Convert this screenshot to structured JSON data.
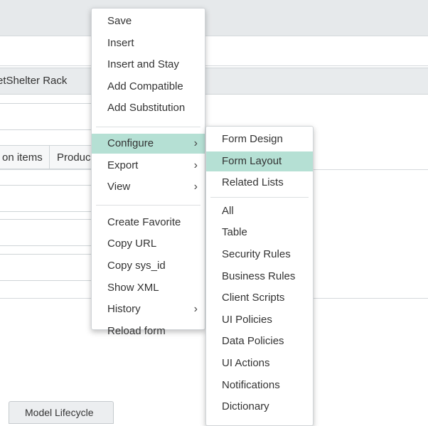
{
  "background": {
    "graybar_text": "etShelter Rack",
    "tabs": [
      "on items",
      "Produc"
    ],
    "bottom_tab": "Model Lifecycle"
  },
  "context_menu": {
    "groups": [
      [
        "Save",
        "Insert",
        "Insert and Stay",
        "Add Compatible",
        "Add Substitution"
      ],
      [
        "Configure",
        "Export",
        "View"
      ],
      [
        "Create Favorite",
        "Copy URL",
        "Copy sys_id",
        "Show XML",
        "History",
        "Reload form"
      ]
    ],
    "submenu_items": [
      "Configure",
      "Export",
      "View",
      "History"
    ],
    "active_item": "Configure",
    "chevron": "chevron-right-icon"
  },
  "configure_submenu": {
    "groups": [
      [
        "Form Design",
        "Form Layout",
        "Related Lists"
      ],
      [
        "All",
        "Table",
        "Security Rules",
        "Business Rules",
        "Client Scripts",
        "UI Policies",
        "Data Policies",
        "UI Actions",
        "Notifications",
        "Dictionary"
      ]
    ],
    "active_item": "Form Layout"
  },
  "colors": {
    "highlight": "#b5e0d4",
    "topbar": "#e6e9eb"
  }
}
